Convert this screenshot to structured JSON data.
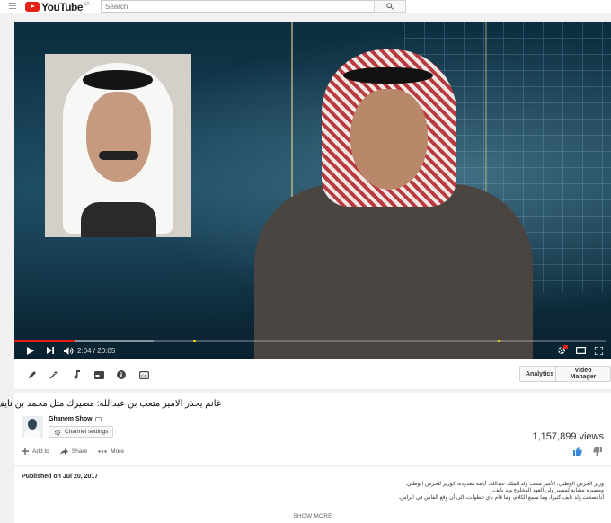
{
  "masthead": {
    "logo_text": "YouTube",
    "region": "SA",
    "search_placeholder": "Search"
  },
  "player": {
    "current_time": "2:04",
    "separator": "/",
    "duration": "20:05",
    "progress_fraction": 0.103,
    "buffered_fraction": 0.235,
    "accent_color": "#e62117"
  },
  "toolbar": {
    "analytics_label": "Analytics",
    "video_manager_label": "Video Manager"
  },
  "video": {
    "title": "غانم يحذر الامير متعب بن عبدالله: مصيرك مثل محمد بن نايف",
    "channel_name": "Ghanem Show",
    "channel_settings_label": "Channel settings",
    "views": "1,157,899 views",
    "add_to_label": "Add to",
    "share_label": "Share",
    "more_label": "More"
  },
  "description": {
    "published": "Published on Jul 20, 2017",
    "lines": [
      "وزير الحرس الوطني، الأمير متعب ولد الملك عبدالله، أيامه معدودة، كوزير للحرس الوطني.",
      "ومصيره مشابه لمصير ولي العهد المخلوع ولد نايف.",
      "أنا نصحت ولد نايف كثيرا، وما سمع الكلام، وما قام بأي خطوات، الى أن وقع الفاس في الراس."
    ],
    "show_more": "SHOW MORE"
  }
}
